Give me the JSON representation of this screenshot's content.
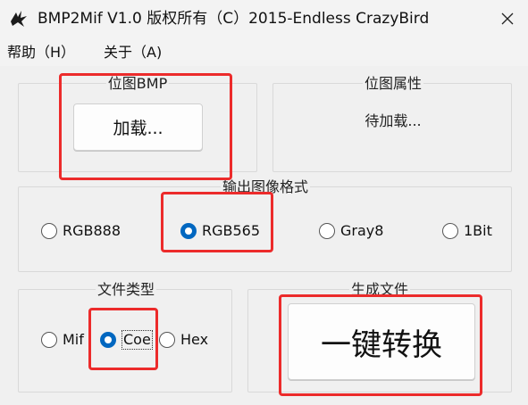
{
  "window": {
    "title": "BMP2Mif V1.0 版权所有（C）2015-Endless CrazyBird",
    "close_glyph": "✕"
  },
  "menu": [
    {
      "label": "帮助（H）"
    },
    {
      "label": "关于（A)"
    }
  ],
  "bitmap_group": {
    "title": "位图BMP",
    "load_button": "加载..."
  },
  "attributes_group": {
    "title": "位图属性",
    "status": "待加载..."
  },
  "format_group": {
    "title": "输出图像格式",
    "options": [
      {
        "label": "RGB888",
        "checked": false
      },
      {
        "label": "RGB565",
        "checked": true
      },
      {
        "label": "Gray8",
        "checked": false
      },
      {
        "label": "1Bit",
        "checked": false
      }
    ]
  },
  "filetype_group": {
    "title": "文件类型",
    "options": [
      {
        "label": "Mif",
        "checked": false
      },
      {
        "label": "Coe",
        "checked": true
      },
      {
        "label": "Hex",
        "checked": false
      }
    ]
  },
  "generate_group": {
    "title": "生成文件",
    "convert_button": "一键转换"
  },
  "colors": {
    "accent": "#0067c0",
    "highlight": "#ec2b2b"
  },
  "icons": {
    "app": "bird-logo-icon",
    "close": "close-icon"
  }
}
